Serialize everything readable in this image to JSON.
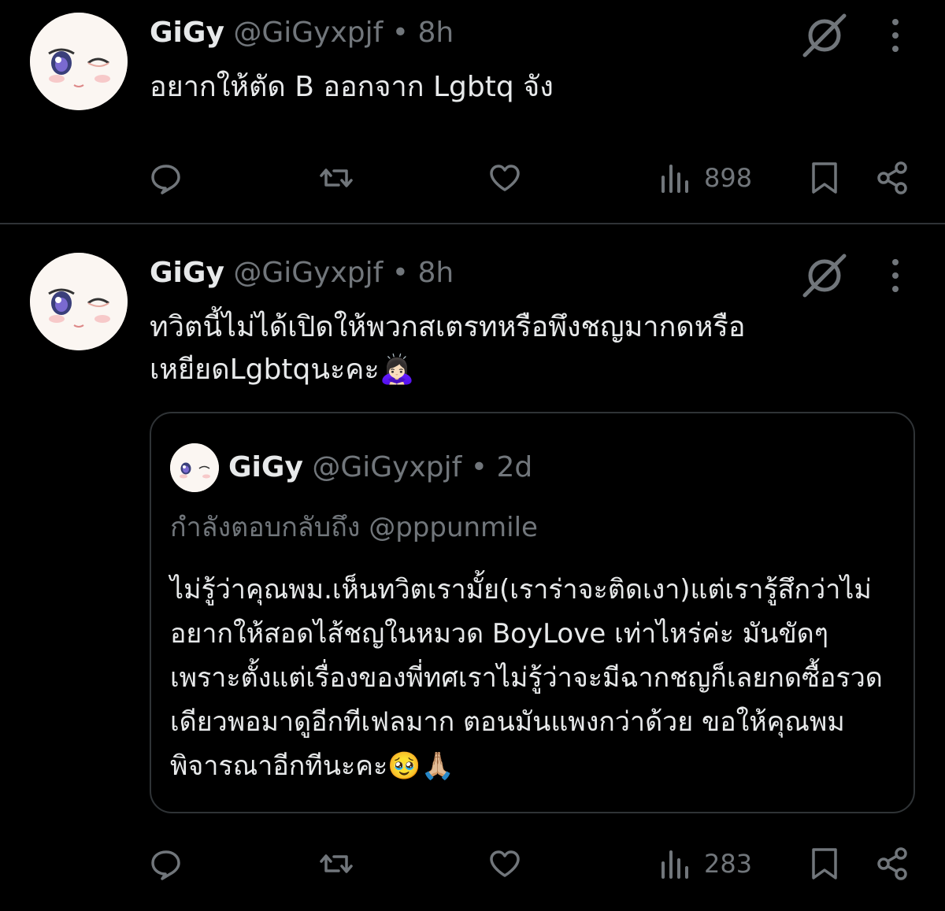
{
  "tweets": [
    {
      "name": "GiGy",
      "handle": "@GiGyxpjf",
      "dot": "•",
      "time": "8h",
      "text": "อยากให้ตัด B ออกจาก Lgbtq จัง",
      "views": "898"
    },
    {
      "name": "GiGy",
      "handle": "@GiGyxpjf",
      "dot": "•",
      "time": "8h",
      "text": "ทวิตนี้ไม่ได้เปิดให้พวกสเตรทหรือพึงชญมากดหรือเหยียดLgbtqนะคะ🙇🏻‍♀️",
      "views": "283",
      "quote": {
        "name": "GiGy",
        "handle": "@GiGyxpjf",
        "dot": "•",
        "time": "2d",
        "reply_prefix": "กำลังตอบกลับถึง",
        "reply_to": "@pppunmile",
        "text": "ไม่รู้ว่าคุณพม.เห็นทวิตเรามั้ย(เราร่าจะติดเงา)แต่เรารู้สึกว่าไม่อยากให้สอดไส้ชญในหมวด BoyLove เท่าไหร่ค่ะ มันขัดๆเพราะตั้งแต่เรื่องของพี่ทศเราไม่รู้ว่าจะมีฉากชญก็เลยกดซื้อรวดเดียวพอมาดูอีกทีเฟลมาก ตอนมันแพงกว่าด้วย ขอให้คุณพมพิจารณาอีกทีนะคะ🥹🙏🏼"
      }
    }
  ],
  "icons": [
    "grok-icon",
    "more-icon",
    "reply-icon",
    "repost-icon",
    "like-icon",
    "views-icon",
    "bookmark-icon",
    "share-icon"
  ],
  "colors": {
    "background": "#000000",
    "text": "#e7e9ea",
    "muted": "#71767b",
    "border": "#2f3336"
  }
}
